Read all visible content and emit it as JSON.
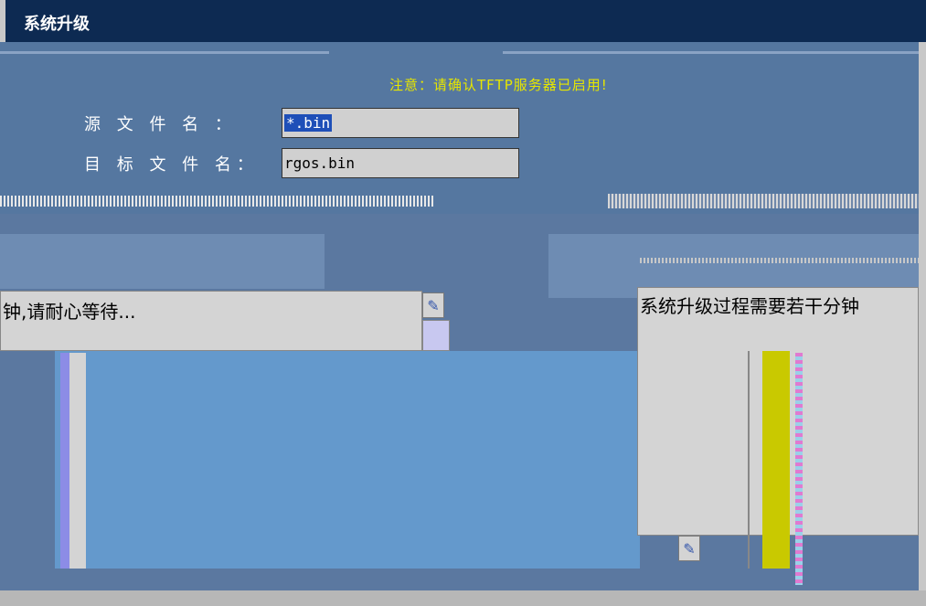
{
  "window": {
    "title": "系统升级"
  },
  "form": {
    "notice": "注意：请确认TFTP服务器已启用!",
    "source_label": "源 文 件 名 ：",
    "source_value": "*.bin",
    "target_label": "目 标 文 件 名：",
    "target_value": "rgos.bin"
  },
  "progress_dialog": {
    "message": "钟,请耐心等待..."
  },
  "info_dialog": {
    "message": "系统升级过程需要若干分钟"
  },
  "icons": {
    "dialog_icon": "dialog-app-icon"
  },
  "colors": {
    "title_bar": "#0d2a52",
    "panel": "#5577a0",
    "notice": "#e6e600",
    "progress_fill": "#c9c900"
  }
}
